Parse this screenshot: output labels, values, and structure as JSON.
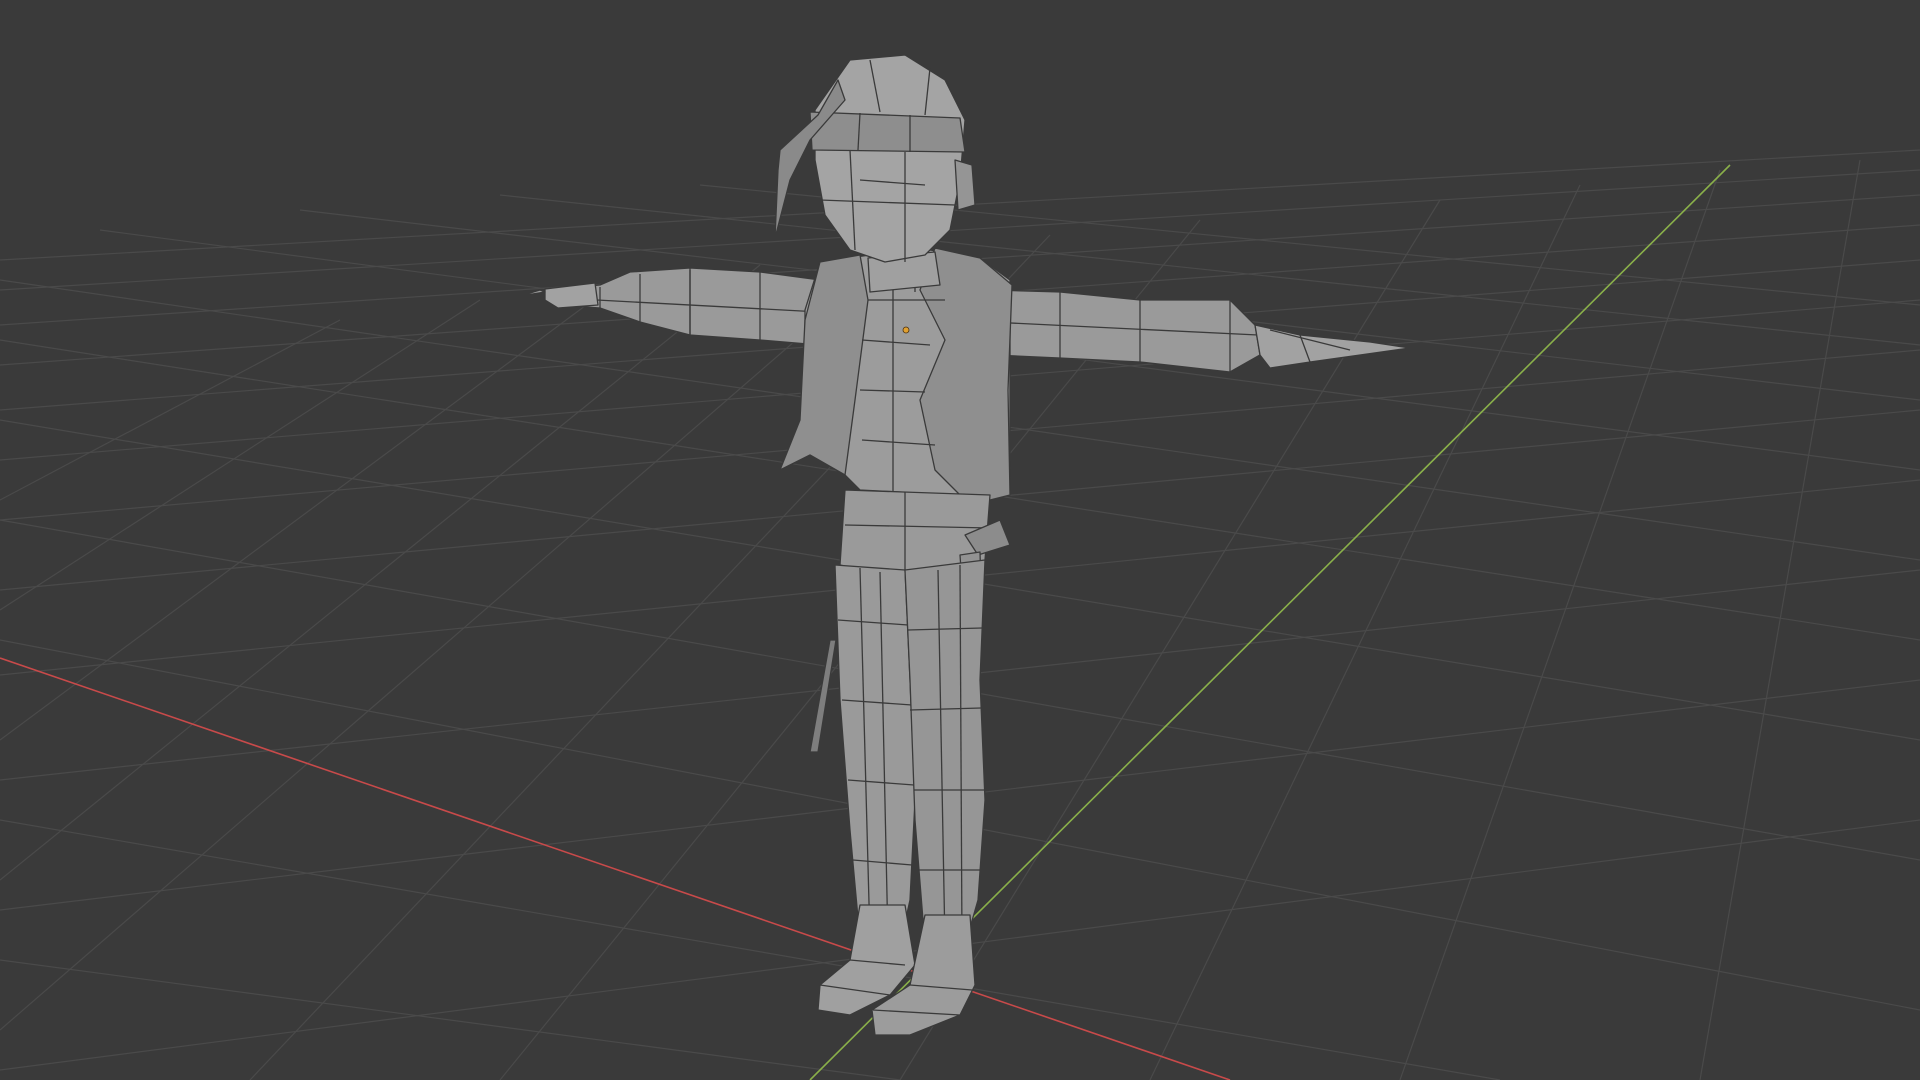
{
  "viewport": {
    "background": "#3a3a3a",
    "grid_color": "#4a4a4a",
    "x_axis_color": "#c84a4a",
    "y_axis_color": "#8ab04a",
    "mesh_fill": "#9a9a9a",
    "mesh_shadow": "#7a7a7a",
    "mesh_wire": "#3a3a3a",
    "origin_color": "#e0a030"
  },
  "scene": {
    "object": "low-poly-character",
    "pose": "t-pose",
    "shading": "solid-with-wireframe"
  }
}
